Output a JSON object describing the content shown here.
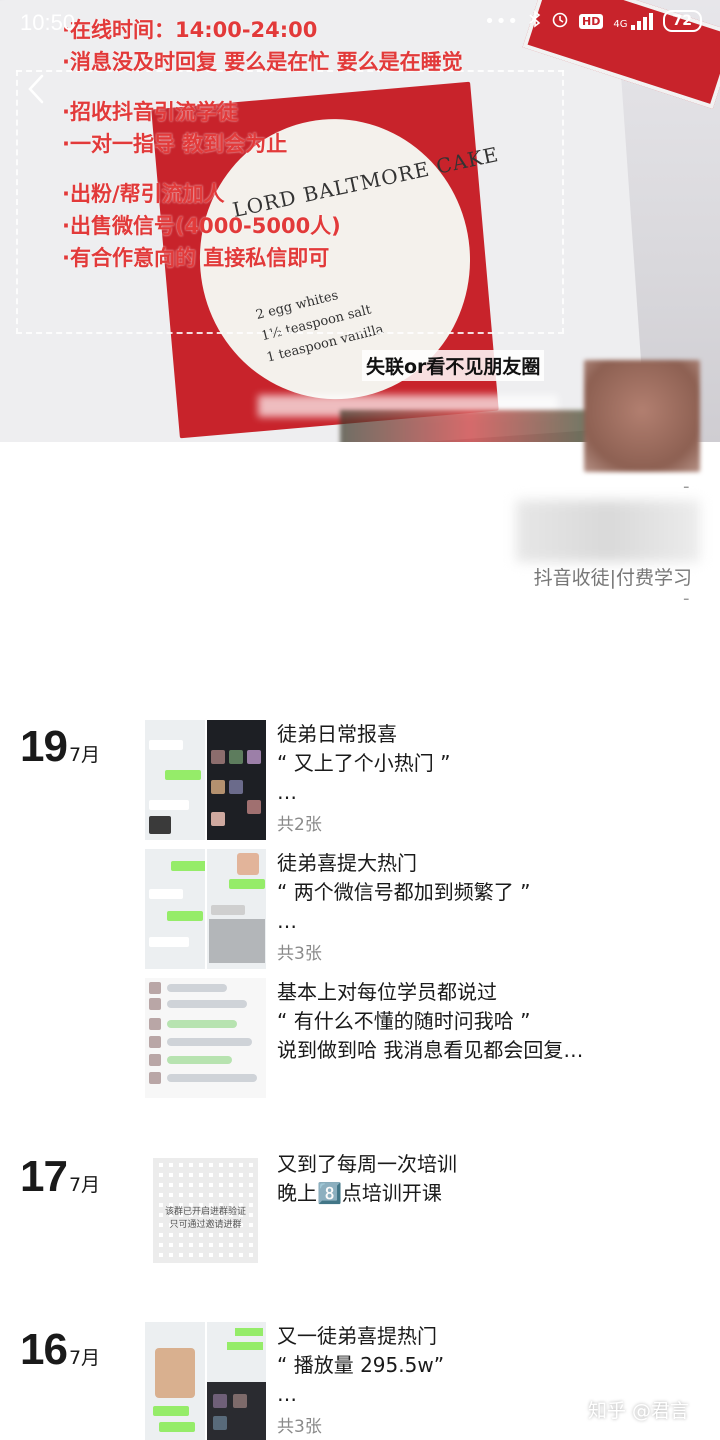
{
  "status_bar": {
    "time": "10:50",
    "network": "4G",
    "hd_label": "HD",
    "battery": "72",
    "more": "•••"
  },
  "cover": {
    "overlay_lines": [
      "·在线时间：14:00-24:00",
      "·消息没及时回复 要么是在忙 要么是在睡觉",
      "",
      "·招收抖音引流学徒",
      "·一对一指导 教到会为止",
      "",
      "·出粉/帮引流加人",
      "·出售微信号(4000-5000人)",
      "·有合作意向的 直接私信即可"
    ],
    "cake_title": "LORD BALTMORE CAKE",
    "recipe_lines": [
      "2 egg whites",
      "1½ teaspoon salt",
      "1 teaspoon vanilla"
    ],
    "label": "失联or看不见朋友圈"
  },
  "profile": {
    "signature": "抖音收徒|付费学习",
    "dash": "-"
  },
  "timeline": [
    {
      "day": "19",
      "month": "7月",
      "posts": [
        {
          "lines": [
            "徒弟日常报喜",
            "“ 又上了个小热门 ”",
            "…"
          ],
          "count": "共2张"
        },
        {
          "lines": [
            "徒弟喜提大热门",
            "“ 两个微信号都加到频繁了 ”",
            "…"
          ],
          "count": "共3张"
        },
        {
          "lines": [
            "基本上对每位学员都说过",
            "“ 有什么不懂的随时问我哈 ”",
            "说到做到哈 我消息看见都会回复…"
          ],
          "count": ""
        }
      ]
    },
    {
      "day": "17",
      "month": "7月",
      "posts": [
        {
          "lines": [
            "又到了每周一次培训",
            "晚上8️⃣点培训开课"
          ],
          "count": "",
          "qr_text": [
            "该群已开启进群验证",
            "只可通过邀请进群"
          ]
        }
      ]
    },
    {
      "day": "16",
      "month": "7月",
      "posts": [
        {
          "lines": [
            "又一徒弟喜提热门",
            "“ 播放量 295.5w”",
            "…"
          ],
          "count": "共3张"
        }
      ]
    }
  ],
  "watermark": "知乎 @君言",
  "colors": {
    "overlay_red": "#e23a3a",
    "card_red": "#c8232b",
    "wechat_green": "#95ec69",
    "muted_text": "#8a8a8a"
  }
}
